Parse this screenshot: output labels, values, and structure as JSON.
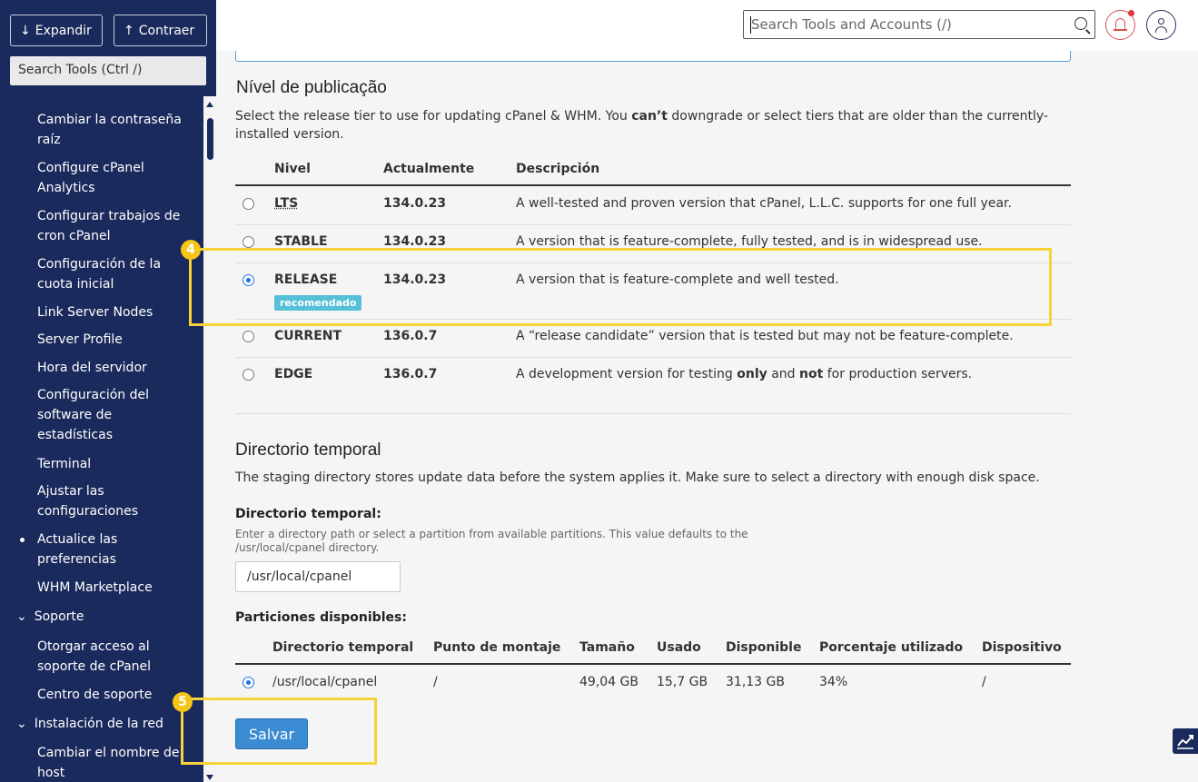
{
  "sidebar": {
    "expand_label": "Expandir",
    "collapse_label": "Contraer",
    "search_placeholder": "Search Tools (Ctrl /)",
    "items": [
      {
        "label": "Cambiar la contraseña raíz"
      },
      {
        "label": "Configure cPanel Analytics"
      },
      {
        "label": "Configurar trabajos de cron cPanel"
      },
      {
        "label": "Configuración de la cuota inicial"
      },
      {
        "label": "Link Server Nodes"
      },
      {
        "label": "Server Profile"
      },
      {
        "label": "Hora del servidor"
      },
      {
        "label": "Configuración del software de estadísticas"
      },
      {
        "label": "Terminal"
      },
      {
        "label": "Ajustar las configuraciones"
      },
      {
        "label": "Actualice las preferencias"
      },
      {
        "label": "WHM Marketplace"
      }
    ],
    "section_support": "Soporte",
    "support_items": [
      {
        "label": "Otorgar acceso al soporte de cPanel"
      },
      {
        "label": "Centro de soporte"
      }
    ],
    "section_network": "Instalación de la red",
    "network_items": [
      {
        "label": "Cambiar el nombre de host"
      }
    ]
  },
  "header": {
    "search_placeholder": "Search Tools and Accounts (/)"
  },
  "release": {
    "title": "Nível de publicação",
    "desc_pre": "Select the release tier to use for updating cPanel & WHM. You ",
    "desc_bold": "can’t",
    "desc_post": " downgrade or select tiers that are older than the currently-installed version.",
    "columns": [
      "Nivel",
      "Actualmente",
      "Descripción"
    ],
    "rows": [
      {
        "tier": "LTS",
        "version": "134.0.23",
        "description": "A well-tested and proven version that cPanel, L.L.C. supports for one full year.",
        "selected": false
      },
      {
        "tier": "STABLE",
        "version": "134.0.23",
        "description": "A version that is feature-complete, fully tested, and is in widespread use.",
        "selected": false
      },
      {
        "tier": "RELEASE",
        "version": "134.0.23",
        "description": "A version that is feature-complete and well tested.",
        "selected": true,
        "badge": "recomendado"
      },
      {
        "tier": "CURRENT",
        "version": "136.0.7",
        "description": "A “release candidate” version that is tested but may not be feature-complete.",
        "selected": false
      },
      {
        "tier": "EDGE",
        "version": "136.0.7",
        "description_parts": [
          "A development version for testing ",
          "only",
          " and ",
          "not",
          " for production servers."
        ],
        "selected": false
      }
    ]
  },
  "staging": {
    "title": "Directorio temporal",
    "desc": "The staging directory stores update data before the system applies it. Make sure to select a directory with enough disk space.",
    "field_label": "Directorio temporal:",
    "field_hint": "Enter a directory path or select a partition from available partitions. This value defaults to the /usr/local/cpanel directory.",
    "field_value": "/usr/local/cpanel",
    "partitions_label": "Particiones disponibles:",
    "columns": [
      "Directorio temporal",
      "Punto de montaje",
      "Tamaño",
      "Usado",
      "Disponible",
      "Porcentaje utilizado",
      "Dispositivo"
    ],
    "rows": [
      {
        "dir": "/usr/local/cpanel",
        "mount": "/",
        "size": "49,04 GB",
        "used": "15,7 GB",
        "available": "31,13 GB",
        "percent": "34%",
        "device": "/",
        "selected": true
      }
    ]
  },
  "save_label": "Salvar",
  "callouts": [
    "4",
    "5"
  ],
  "colors": {
    "sidebar_bg": "#1b2a5c",
    "callout": "#f5d33b",
    "primary": "#3a8bd1",
    "badge": "#56c0d8",
    "alert": "#d9534f"
  }
}
